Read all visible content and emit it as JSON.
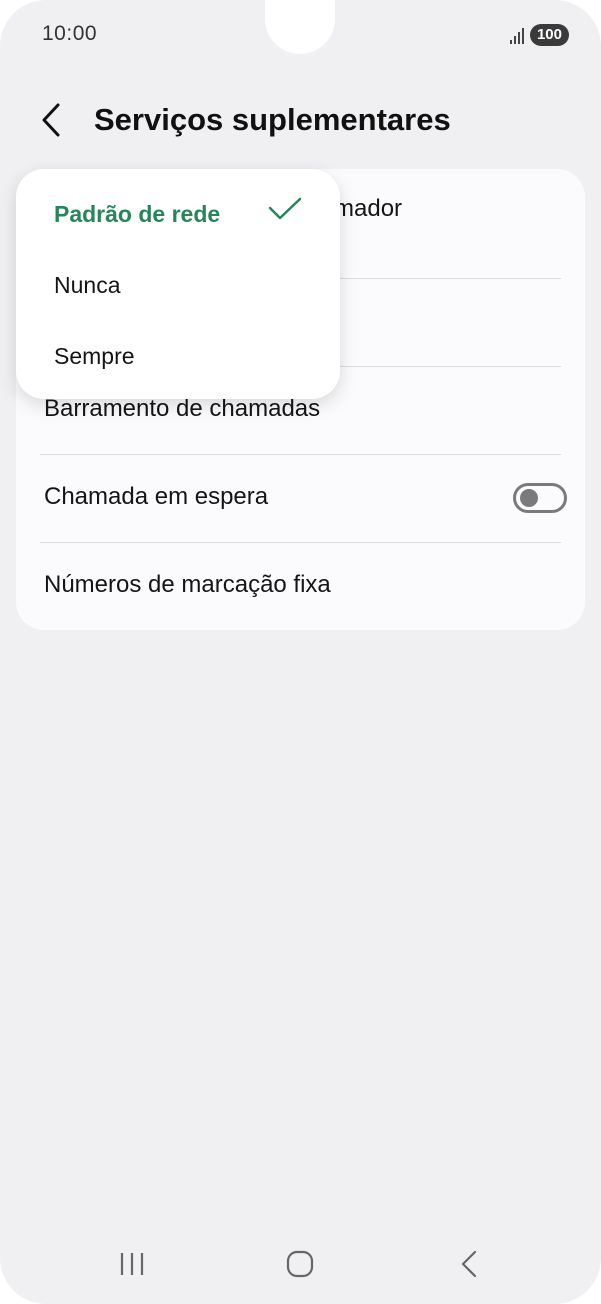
{
  "status_bar": {
    "time": "10:00",
    "battery": "100"
  },
  "header": {
    "title": "Serviços suplementares"
  },
  "settings": {
    "row1_tail": "mador",
    "call_barring": "Barramento de chamadas",
    "call_waiting": "Chamada em espera",
    "call_waiting_enabled": false,
    "fixed_dialing": "Números de marcação fixa"
  },
  "popup": {
    "options": [
      {
        "label": "Padrão de rede",
        "selected": true
      },
      {
        "label": "Nunca",
        "selected": false
      },
      {
        "label": "Sempre",
        "selected": false
      }
    ]
  },
  "colors": {
    "accent": "#25865c",
    "background": "#f0f0f3",
    "card": "#fbfbfd"
  },
  "icons": {
    "back": "chevron-left-icon",
    "check": "checkmark-icon",
    "recents": "recents-icon",
    "home": "home-icon",
    "nav_back": "back-icon"
  }
}
